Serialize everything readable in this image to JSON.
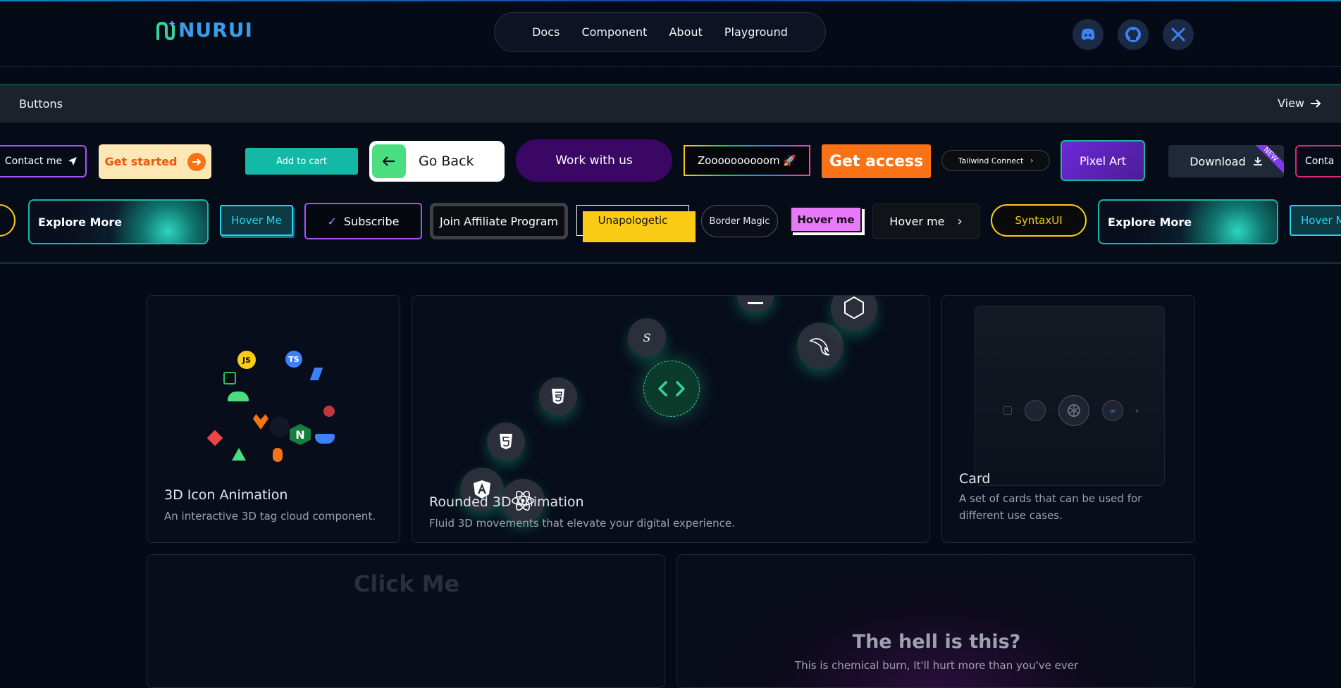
{
  "brand": {
    "name": "NURUI"
  },
  "nav": {
    "items": [
      "Docs",
      "Component",
      "About",
      "Playground"
    ]
  },
  "social": [
    "discord-icon",
    "github-icon",
    "x-icon"
  ],
  "band": {
    "title": "Buttons",
    "view_label": "View",
    "row1": {
      "contact_me": "Contact me",
      "get_started": "Get started",
      "add_to_cart": "Add to cart",
      "go_back": "Go Back",
      "work_with_us": "Work with us",
      "zoom": "Zoooooooooom 🚀",
      "get_access": "Get access",
      "tailwind_connect": "Tailwind Connect",
      "pixel_art": "Pixel Art",
      "download": "Download",
      "new_badge": "NEW",
      "contact_partial": "Conta"
    },
    "row2": {
      "explore_more": "Explore More",
      "hover_me_cyan": "Hover Me",
      "subscribe": "Subscribe",
      "join_affiliate": "Join Affiliate Program",
      "unapologetic": "Unapologetic",
      "border_magic": "Border Magic",
      "hover_me_pink": "Hover me",
      "hover_me_dark": "Hover me",
      "syntaxui": "SyntaxUI",
      "explore_more_2": "Explore More",
      "hover_me_partial": "Hover M"
    }
  },
  "cards": {
    "icon3d": {
      "title": "3D Icon Animation",
      "desc": "An interactive 3D tag cloud component."
    },
    "rounded3d": {
      "title": "Rounded 3D Animation",
      "desc": "Fluid 3D movements that elevate your digital experience."
    },
    "card": {
      "title": "Card",
      "desc": "A set of cards that can be used for different use cases."
    },
    "click": {
      "label": "Click Me"
    },
    "hell": {
      "title": "The hell is this?",
      "desc": "This is chemical burn, It'll hurt more than you've ever"
    }
  },
  "tags": {
    "js": "JS",
    "ts": "TS",
    "n": "N"
  },
  "colors": {
    "accent": "#3b9ce9",
    "band_border": "#2b7f6e",
    "orange": "#f97316",
    "teal": "#14b8a6",
    "purple": "#3b0764"
  }
}
